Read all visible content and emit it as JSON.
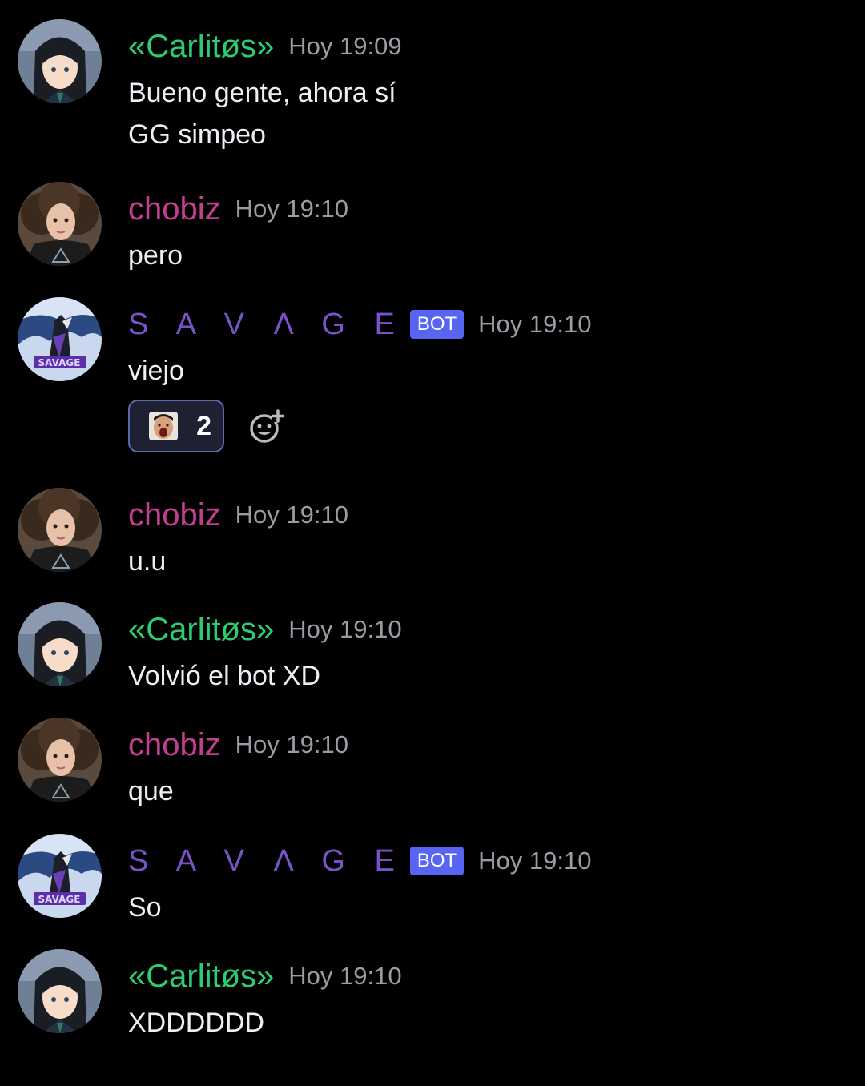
{
  "messages": [
    {
      "author": "«Carlitøs»",
      "author_style": "carlitos",
      "avatar": "anime-girl-avatar",
      "time": "Hoy 19:09",
      "bot": false,
      "lines": [
        "Bueno gente, ahora sí",
        "GG simpeo"
      ]
    },
    {
      "author": "chobiz",
      "author_style": "chobiz",
      "avatar": "curly-hair-girl-avatar",
      "time": "Hoy 19:10",
      "bot": false,
      "lines": [
        "pero"
      ]
    },
    {
      "author": "S A V Λ G E",
      "author_style": "savage",
      "avatar": "wolf-logo-avatar",
      "time": "Hoy 19:10",
      "bot": true,
      "bot_label": "BOT",
      "lines": [
        "viejo"
      ],
      "reaction": {
        "emoji": "screaming-face-emoji",
        "count": "2"
      }
    },
    {
      "author": "chobiz",
      "author_style": "chobiz",
      "avatar": "curly-hair-girl-avatar",
      "time": "Hoy 19:10",
      "bot": false,
      "lines": [
        "u.u"
      ]
    },
    {
      "author": "«Carlitøs»",
      "author_style": "carlitos",
      "avatar": "anime-girl-avatar",
      "time": "Hoy 19:10",
      "bot": false,
      "lines": [
        "Volvió el bot XD"
      ]
    },
    {
      "author": "chobiz",
      "author_style": "chobiz",
      "avatar": "curly-hair-girl-avatar",
      "time": "Hoy 19:10",
      "bot": false,
      "lines": [
        "que"
      ]
    },
    {
      "author": "S A V Λ G E",
      "author_style": "savage",
      "avatar": "wolf-logo-avatar",
      "time": "Hoy 19:10",
      "bot": true,
      "bot_label": "BOT",
      "lines": [
        "So"
      ]
    },
    {
      "author": "«Carlitøs»",
      "author_style": "carlitos",
      "avatar": "anime-girl-avatar",
      "time": "Hoy 19:10",
      "bot": false,
      "lines": [
        "XDDDDDD"
      ]
    }
  ],
  "colors": {
    "background": "#000000",
    "carlitos_name": "#2ecc71",
    "chobiz_name": "#c23f8f",
    "savage_name": "#7a52c7",
    "bot_badge": "#5865f2",
    "timestamp": "#9a9ca3",
    "message_text": "#eceff4"
  },
  "icons": {
    "add_reaction": "add-reaction-icon"
  }
}
